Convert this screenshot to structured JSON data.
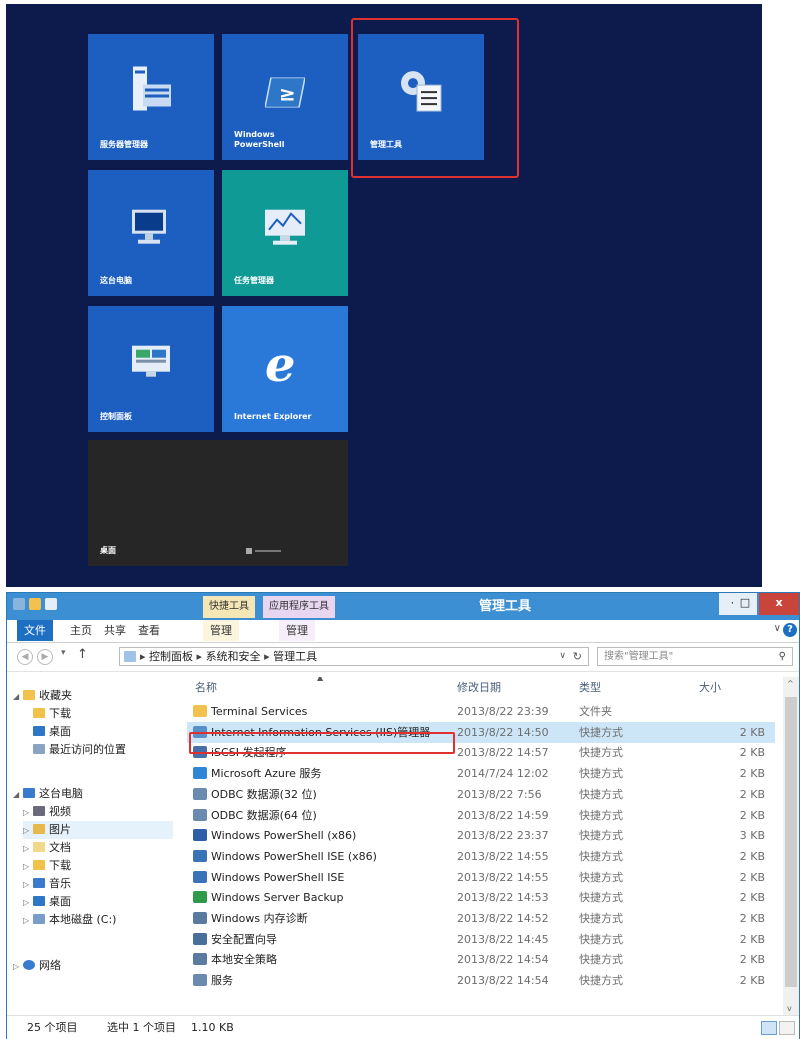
{
  "start_screen": {
    "tiles": [
      {
        "id": "server-manager",
        "label": "服务器管理器"
      },
      {
        "id": "powershell",
        "label": "Windows\nPowerShell"
      },
      {
        "id": "admin-tools",
        "label": "管理工具"
      },
      {
        "id": "this-pc",
        "label": "这台电脑"
      },
      {
        "id": "task-manager",
        "label": "任务管理器"
      },
      {
        "id": "control-panel",
        "label": "控制面板"
      },
      {
        "id": "ie",
        "label": "Internet Explorer"
      },
      {
        "id": "desktop",
        "label": "桌面"
      }
    ],
    "colors": {
      "background": "#0c1b4b",
      "tile_blue": "#1c5fc0",
      "tile_teal": "#0f9a95",
      "tile_dark": "#262626",
      "highlight": "#e03030"
    }
  },
  "explorer": {
    "title": "管理工具",
    "context_tabs": [
      "快捷工具",
      "应用程序工具"
    ],
    "ribbon_tabs": [
      "文件",
      "主页",
      "共享",
      "查看",
      "管理",
      "管理"
    ],
    "window_buttons": {
      "minimize": "–",
      "maximize": "□",
      "close": "x"
    },
    "help": "?",
    "address_path": [
      "控制面板",
      "系统和安全",
      "管理工具"
    ],
    "search_placeholder": "搜索\"管理工具\"",
    "columns": [
      "名称",
      "修改日期",
      "类型",
      "大小"
    ],
    "nav": {
      "favorites": {
        "label": "收藏夹",
        "items": [
          "下载",
          "桌面",
          "最近访问的位置"
        ]
      },
      "this_pc": {
        "label": "这台电脑",
        "items": [
          "视频",
          "图片",
          "文档",
          "下载",
          "音乐",
          "桌面",
          "本地磁盘 (C:)"
        ]
      },
      "network": "网络"
    },
    "files": [
      {
        "name": "Terminal Services",
        "date": "2013/8/22 23:39",
        "type": "文件夹",
        "size": "",
        "icon": "folder-icon"
      },
      {
        "name": "Internet Information Services (IIS)管理器",
        "date": "2013/8/22 14:50",
        "type": "快捷方式",
        "size": "2 KB",
        "icon": "iis-icon"
      },
      {
        "name": "iSCSI 发起程序",
        "date": "2013/8/22 14:57",
        "type": "快捷方式",
        "size": "2 KB",
        "icon": "iscsi-icon"
      },
      {
        "name": "Microsoft Azure 服务",
        "date": "2014/7/24 12:02",
        "type": "快捷方式",
        "size": "2 KB",
        "icon": "azure-icon"
      },
      {
        "name": "ODBC 数据源(32 位)",
        "date": "2013/8/22 7:56",
        "type": "快捷方式",
        "size": "2 KB",
        "icon": "odbc-icon"
      },
      {
        "name": "ODBC 数据源(64 位)",
        "date": "2013/8/22 14:59",
        "type": "快捷方式",
        "size": "2 KB",
        "icon": "odbc-icon"
      },
      {
        "name": "Windows PowerShell (x86)",
        "date": "2013/8/22 23:37",
        "type": "快捷方式",
        "size": "3 KB",
        "icon": "powershell-icon"
      },
      {
        "name": "Windows PowerShell ISE (x86)",
        "date": "2013/8/22 14:55",
        "type": "快捷方式",
        "size": "2 KB",
        "icon": "powershell-ise-icon"
      },
      {
        "name": "Windows PowerShell ISE",
        "date": "2013/8/22 14:55",
        "type": "快捷方式",
        "size": "2 KB",
        "icon": "powershell-ise-icon"
      },
      {
        "name": "Windows Server Backup",
        "date": "2013/8/22 14:53",
        "type": "快捷方式",
        "size": "2 KB",
        "icon": "backup-icon"
      },
      {
        "name": "Windows 内存诊断",
        "date": "2013/8/22 14:52",
        "type": "快捷方式",
        "size": "2 KB",
        "icon": "memory-icon"
      },
      {
        "name": "安全配置向导",
        "date": "2013/8/22 14:45",
        "type": "快捷方式",
        "size": "2 KB",
        "icon": "security-icon"
      },
      {
        "name": "本地安全策略",
        "date": "2013/8/22 14:54",
        "type": "快捷方式",
        "size": "2 KB",
        "icon": "policy-icon"
      },
      {
        "name": "服务",
        "date": "2013/8/22 14:54",
        "type": "快捷方式",
        "size": "2 KB",
        "icon": "services-icon"
      }
    ],
    "status": {
      "count": "25 个项目",
      "selected": "选中 1 个项目",
      "size": "1.10 KB"
    }
  }
}
